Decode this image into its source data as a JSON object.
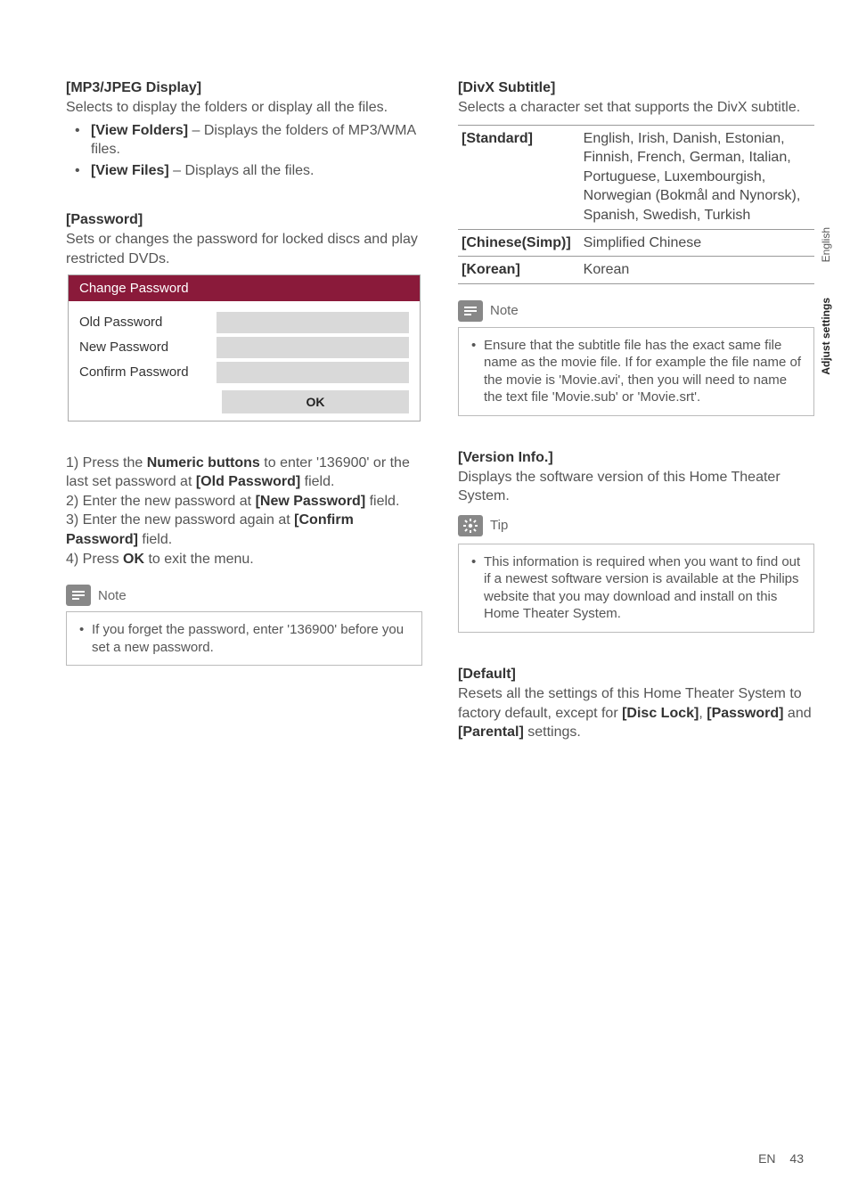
{
  "left": {
    "mp3": {
      "heading": "[MP3/JPEG Display]",
      "text": "Selects to display the folders or display all the files.",
      "items": [
        {
          "label": "[View Folders]",
          "desc": " – Displays the folders of MP3/WMA files."
        },
        {
          "label": "[View Files]",
          "desc": " – Displays all the files."
        }
      ]
    },
    "password": {
      "heading": "[Password]",
      "text": "Sets or changes the password for locked discs and play restricted DVDs.",
      "dialog": {
        "title": "Change Password",
        "rows": [
          "Old Password",
          "New Password",
          "Confirm Password"
        ],
        "ok": "OK"
      },
      "steps": {
        "s1a": "1) Press the ",
        "s1b": "Numeric buttons",
        "s1c": " to enter '136900' or the last set password at ",
        "s1d": "[Old Password]",
        "s1e": " field.",
        "s2a": "2) Enter the new password at ",
        "s2b": "[New Password]",
        "s2c": " field.",
        "s3a": "3) Enter the new password again at ",
        "s3b": "[Confirm Password]",
        "s3c": " field.",
        "s4a": "4) Press ",
        "s4b": "OK",
        "s4c": " to exit the menu."
      },
      "note_label": "Note",
      "note_text": "If you forget the password, enter '136900' before you set a new password."
    }
  },
  "right": {
    "divx": {
      "heading": "[DivX Subtitle]",
      "text": "Selects a character set that supports the DivX subtitle.",
      "rows": [
        {
          "label": "[Standard]",
          "value": "English, Irish, Danish, Estonian, Finnish, French, German, Italian, Portuguese, Luxembourgish, Norwegian (Bokmål and Nynorsk), Spanish, Swedish, Turkish"
        },
        {
          "label": "[Chinese(Simp)]",
          "value": "Simplified Chinese"
        },
        {
          "label": "[Korean]",
          "value": "Korean"
        }
      ],
      "note_label": "Note",
      "note_text": "Ensure that the subtitle file has the exact same file name as the movie file. If for example the file name of the movie is 'Movie.avi', then you will need to name the text file 'Movie.sub' or 'Movie.srt'."
    },
    "version": {
      "heading": "[Version Info.]",
      "text": "Displays the software version of this Home Theater System.",
      "tip_label": "Tip",
      "tip_text": "This information is required when you want to find out if a newest software version is available at the Philips website that you may download and install on this Home Theater System."
    },
    "default": {
      "heading": "[Default]",
      "t1": "Resets all the settings of this Home Theater System to factory default, except for ",
      "b1": "[Disc Lock]",
      "t2": ", ",
      "b2": "[Password]",
      "t3": " and ",
      "b3": "[Parental]",
      "t4": " settings."
    }
  },
  "side": {
    "lang": "English",
    "section": "Adjust settings"
  },
  "footer": {
    "lang": "EN",
    "page": "43"
  }
}
